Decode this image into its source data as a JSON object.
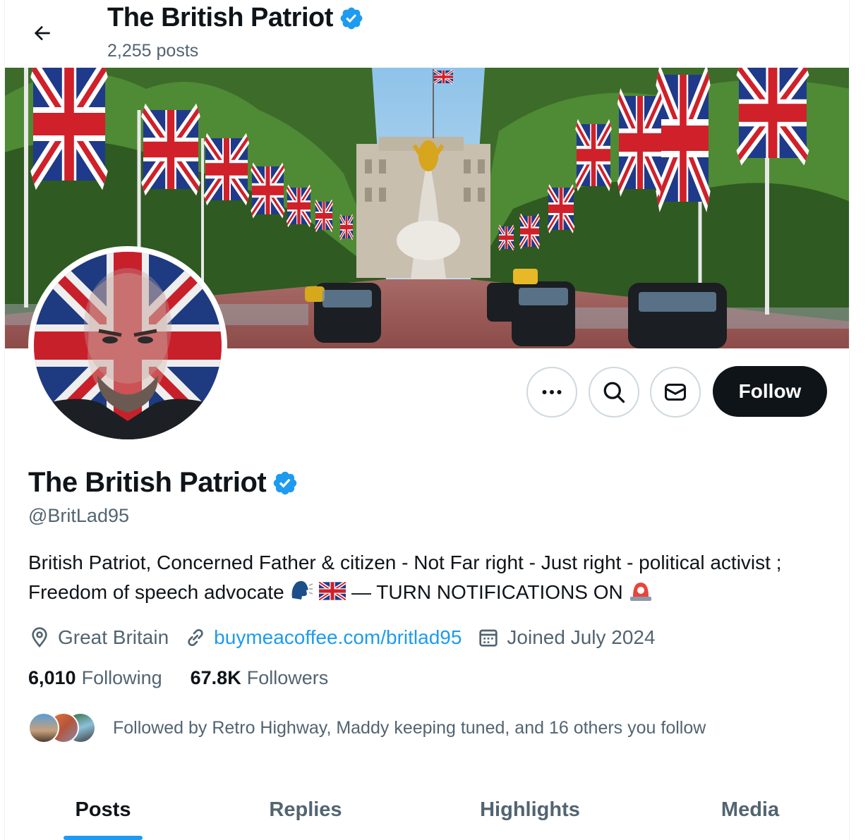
{
  "header": {
    "title": "The British Patriot",
    "post_count": "2,255 posts"
  },
  "profile": {
    "display_name": "The British Patriot",
    "handle": "@BritLad95",
    "bio_text": "British Patriot, Concerned Father & citizen - Not Far right - Just right - political activist ; Freedom of speech advocate",
    "bio_suffix": "— TURN NOTIFICATIONS ON",
    "location": "Great Britain",
    "website": "buymeacoffee.com/britlad95",
    "joined": "Joined July 2024",
    "following_count": "6,010",
    "following_label": "Following",
    "followers_count": "67.8K",
    "followers_label": "Followers",
    "followed_by": "Followed by Retro Highway, Maddy keeping tuned, and 16 others you follow"
  },
  "actions": {
    "follow_label": "Follow"
  },
  "tabs": [
    {
      "label": "Posts",
      "active": true
    },
    {
      "label": "Replies",
      "active": false
    },
    {
      "label": "Highlights",
      "active": false
    },
    {
      "label": "Media",
      "active": false
    }
  ],
  "icons": {
    "back": "arrow-left-icon",
    "verified": "verified-badge-icon",
    "more": "more-icon",
    "search": "search-icon",
    "message": "envelope-icon",
    "location": "location-pin-icon",
    "link": "link-icon",
    "calendar": "calendar-icon"
  },
  "colors": {
    "accent": "#1d9bf0",
    "text_primary": "#0f1419",
    "text_secondary": "#536471",
    "follow_bg": "#0f1419"
  }
}
